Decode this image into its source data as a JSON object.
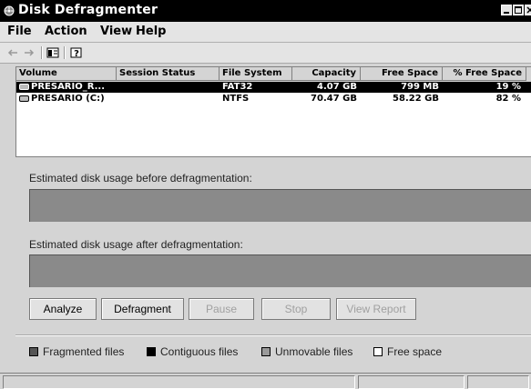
{
  "window": {
    "title": "Disk Defragmenter",
    "icons": {
      "app": "defrag-app-icon",
      "minimize": "minimize-icon",
      "maximize": "maximize-icon",
      "close": "close-icon"
    }
  },
  "menu": {
    "items": [
      "File",
      "Action",
      "View",
      "Help"
    ]
  },
  "toolbar": {
    "icons": [
      "back-arrow-icon",
      "forward-arrow-icon",
      "show-hide-console-tree-icon",
      "help-icon"
    ]
  },
  "volumes": {
    "columns": [
      "Volume",
      "Session Status",
      "File System",
      "Capacity",
      "Free Space",
      "% Free Space"
    ],
    "rows": [
      {
        "volume": "PRESARIO_R...",
        "status": "",
        "fs": "FAT32",
        "capacity": "4.07 GB",
        "free": "799 MB",
        "pct": "19 %",
        "selected": true
      },
      {
        "volume": "PRESARIO (C:)",
        "status": "",
        "fs": "NTFS",
        "capacity": "70.47 GB",
        "free": "58.22 GB",
        "pct": "82 %",
        "selected": false
      }
    ]
  },
  "analysis": {
    "before_label": "Estimated disk usage before defragmentation:",
    "after_label": "Estimated disk usage after defragmentation:"
  },
  "buttons": {
    "analyze": "Analyze",
    "defragment": "Defragment",
    "pause": "Pause",
    "stop": "Stop",
    "view_report": "View Report"
  },
  "legend": {
    "fragmented": {
      "label": "Fragmented files",
      "color": "#555555"
    },
    "contiguous": {
      "label": "Contiguous files",
      "color": "#000000"
    },
    "unmovable": {
      "label": "Unmovable files",
      "color": "#9a9a9a"
    },
    "free": {
      "label": "Free space",
      "color": "#ffffff"
    }
  }
}
